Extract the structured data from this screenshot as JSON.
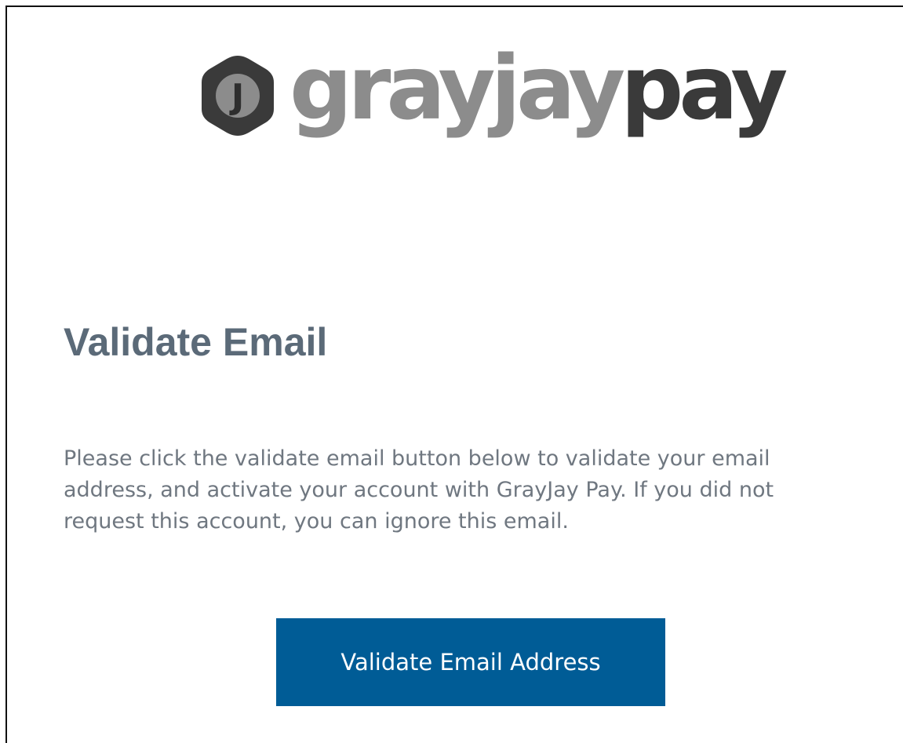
{
  "brand": {
    "badge_letter": "J",
    "name_part_light": "grayjay",
    "name_part_dark": "pay",
    "badge_icon": "hexagon-j-logo-icon",
    "colors": {
      "light": "#8c8c8c",
      "dark": "#3a3a3a",
      "badge": "#3a3a3a"
    }
  },
  "email": {
    "heading": "Validate Email",
    "message": "Please click the validate email button below to validate your email address, and activate your account with GrayJay Pay. If you did not request this account, you can ignore this email.",
    "button_label": "Validate Email Address"
  },
  "colors": {
    "heading": "#5b6a78",
    "body_text": "#6f7780",
    "button_bg": "#005c96",
    "button_text": "#ffffff"
  }
}
